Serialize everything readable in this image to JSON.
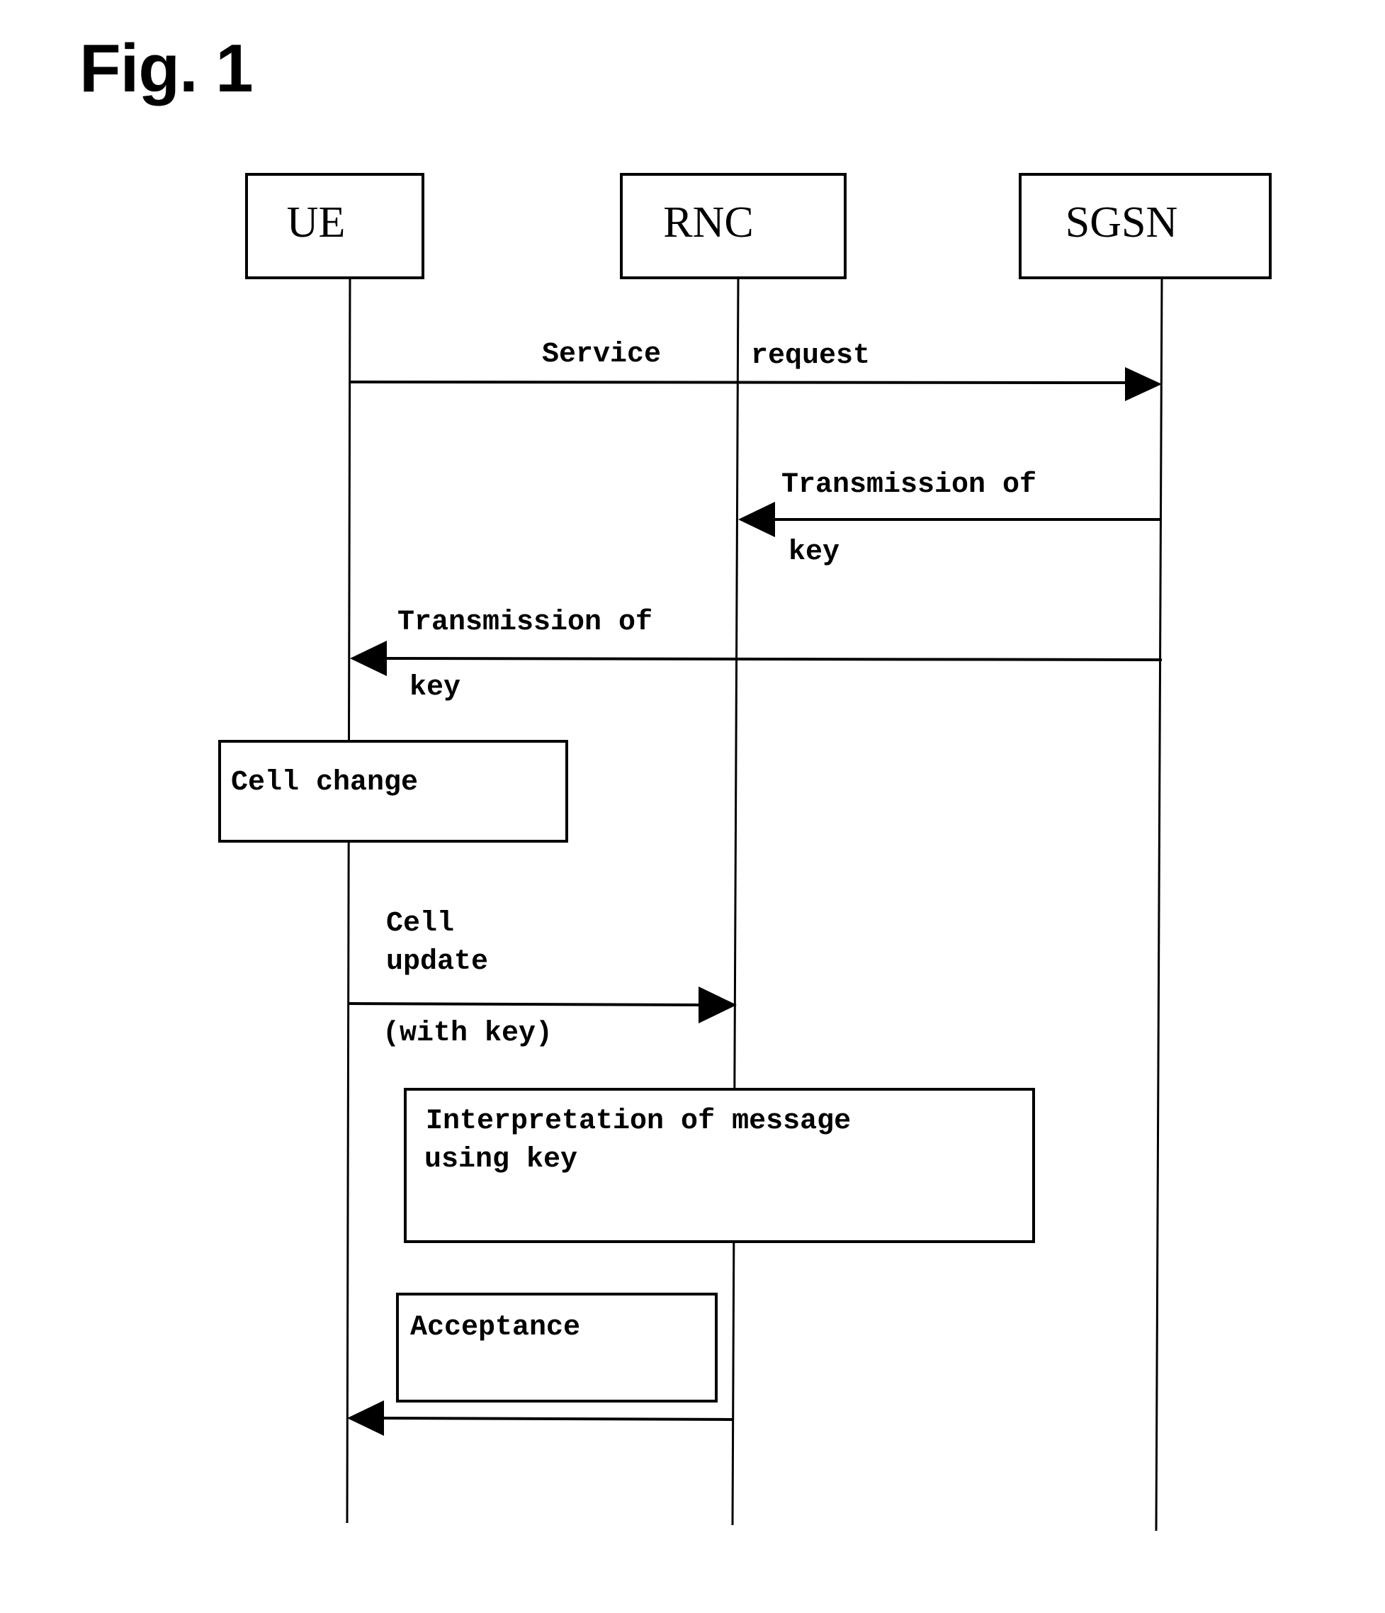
{
  "figure": {
    "title": "Fig. 1"
  },
  "actors": [
    {
      "id": "ue",
      "label": "UE"
    },
    {
      "id": "rnc",
      "label": "RNC"
    },
    {
      "id": "sgsn",
      "label": "SGSN"
    }
  ],
  "messages": [
    {
      "id": "service-request",
      "from": "UE",
      "to": "SGSN",
      "label_parts": [
        "Service",
        "request"
      ]
    },
    {
      "id": "key-to-rnc",
      "from": "SGSN",
      "to": "RNC",
      "label_above": "Transmission of",
      "label_below": "key"
    },
    {
      "id": "key-to-ue",
      "from": "SGSN",
      "to": "UE",
      "label_above": "Transmission of",
      "label_below": "key"
    },
    {
      "id": "cell-update",
      "from": "UE",
      "to": "RNC",
      "label_above_lines": [
        "Cell",
        "update"
      ],
      "label_below": "(with key)"
    },
    {
      "id": "acceptance-reply",
      "from": "RNC",
      "to": "UE"
    }
  ],
  "process_boxes": [
    {
      "id": "cell-change",
      "lines": [
        "Cell change"
      ]
    },
    {
      "id": "interpretation",
      "lines": [
        "Interpretation of message",
        "using key"
      ]
    },
    {
      "id": "acceptance",
      "lines": [
        "Acceptance"
      ]
    }
  ]
}
